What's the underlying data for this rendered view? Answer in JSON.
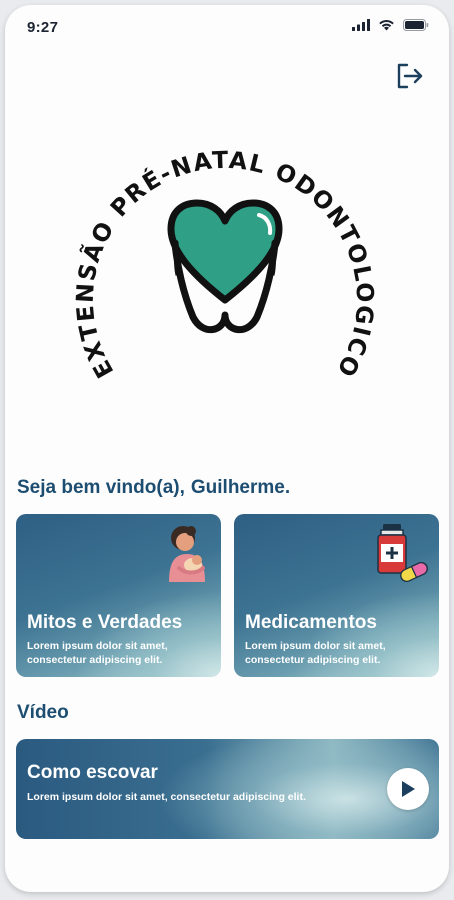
{
  "status_bar": {
    "time": "9:27",
    "icons": [
      "cellular-signal-icon",
      "wifi-icon",
      "battery-icon"
    ]
  },
  "header": {
    "logout_icon": "logout-icon"
  },
  "logo": {
    "curved_text": "EXTENSÃO PRÉ-NATAL ODONTOLÓGICO",
    "icon": "heart-tooth-icon",
    "colors": {
      "heart": "#2f9f86",
      "outline": "#111111"
    }
  },
  "welcome": {
    "greeting": "Seja bem vindo(a),",
    "name": "Guilherme."
  },
  "cards": [
    {
      "title": "Mitos e Verdades",
      "description": "Lorem ipsum dolor sit amet, consectetur adipiscing elit.",
      "illustration": "mother-baby-icon"
    },
    {
      "title": "Medicamentos",
      "description": "Lorem ipsum dolor sit amet, consectetur adipiscing elit.",
      "illustration": "medicine-bottle-pills-icon"
    }
  ],
  "video_section": {
    "heading": "Vídeo",
    "card": {
      "title": "Como escovar",
      "description": "Lorem ipsum dolor sit amet, consectetur adipiscing elit.",
      "action_icon": "play-icon"
    }
  },
  "theme": {
    "primary_text": "#1d4e72",
    "card_dark": "#2e5f84",
    "card_light": "#b7d6d8"
  }
}
